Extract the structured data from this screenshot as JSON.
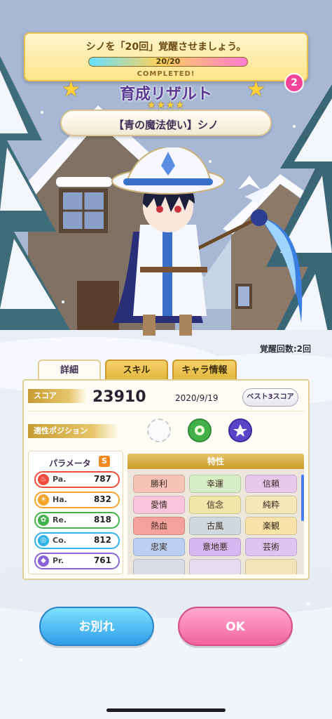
{
  "mission": {
    "text": "シノを「20回」覚醒させましょう。",
    "count": "20/20",
    "progress": 1.0,
    "status": "COMPLETED!",
    "badge": "2"
  },
  "title": {
    "text": "育成リザルト",
    "rarity": "★★★★"
  },
  "character": {
    "name": "【青の魔法使い】シノ",
    "awaken_label": "覚醒回数:2回"
  },
  "tabs": [
    {
      "label": "詳細",
      "active": true
    },
    {
      "label": "スキル",
      "active": false
    },
    {
      "label": "キャラ情報",
      "active": false
    }
  ],
  "score": {
    "label": "スコア",
    "value": "23910",
    "date": "2020/9/19",
    "best_button": "ベスト3スコア"
  },
  "position": {
    "label": "適性ポジション"
  },
  "params": {
    "header": "パラメータ",
    "rank": "S",
    "stats": [
      {
        "name": "Pa.",
        "value": "787",
        "color": "#f04b3b",
        "icon": "flame-icon"
      },
      {
        "name": "Ha.",
        "value": "832",
        "color": "#f2a529",
        "icon": "sun-icon"
      },
      {
        "name": "Re.",
        "value": "818",
        "color": "#42b34a",
        "icon": "clover-icon"
      },
      {
        "name": "Co.",
        "value": "812",
        "color": "#2fb3e8",
        "icon": "water-icon"
      },
      {
        "name": "Pr.",
        "value": "761",
        "color": "#8a63d8",
        "icon": "diamond-icon"
      }
    ]
  },
  "traits": {
    "header": "特性",
    "items": [
      {
        "label": "勝利",
        "color": "#f7c3b6"
      },
      {
        "label": "幸運",
        "color": "#d8edc4"
      },
      {
        "label": "信頼",
        "color": "#e9c8ee"
      },
      {
        "label": "愛情",
        "color": "#f7c6dc"
      },
      {
        "label": "信念",
        "color": "#f0e6a8"
      },
      {
        "label": "純粋",
        "color": "#f4e8b8"
      },
      {
        "label": "熱血",
        "color": "#f3a19a"
      },
      {
        "label": "古風",
        "color": "#cfd8de"
      },
      {
        "label": "楽観",
        "color": "#f7e3a7"
      },
      {
        "label": "忠実",
        "color": "#b9d0f4"
      },
      {
        "label": "意地悪",
        "color": "#d6b7ef"
      },
      {
        "label": "芸術",
        "color": "#dcc5f2"
      }
    ]
  },
  "buttons": {
    "farewell": "お別れ",
    "ok": "OK"
  }
}
